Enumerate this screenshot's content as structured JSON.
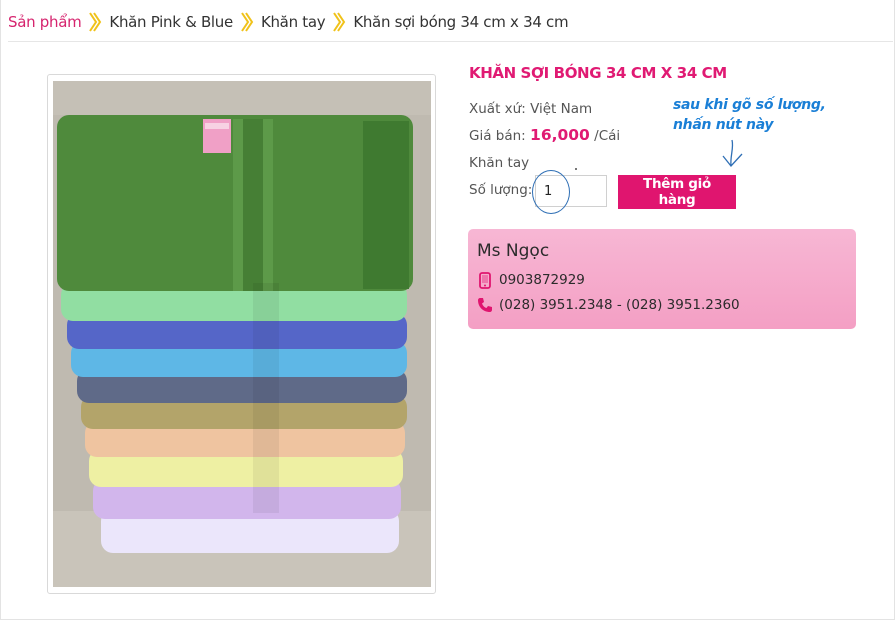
{
  "breadcrumb": {
    "items": [
      "Sản phẩm",
      "Khăn Pink & Blue",
      "Khăn tay",
      "Khăn sợi bóng 34 cm x 34 cm"
    ],
    "separator_icon": "double-chevron-right-icon",
    "accent_color": "#d6246e",
    "separator_color": "#f0c21a"
  },
  "product": {
    "title": "KHĂN SỢI BÓNG 34 CM X 34 CM",
    "origin_label": "Xuất xứ:",
    "origin_value": "Việt Nam",
    "price_label": "Giá bán:",
    "price_value": "16,000",
    "price_unit": "/Cái",
    "category": "Khăn tay",
    "quantity_label": "Số lượng:",
    "quantity_value": "1",
    "add_to_cart_label": "Thêm giỏ hàng",
    "image_alt": "towel-stack-image"
  },
  "annotation": {
    "line1": "sau khi gõ số lượng,",
    "line2": "nhấn nút này",
    "color": "#1a7fd6"
  },
  "contact": {
    "name": "Ms Ngọc",
    "mobile": "0903872929",
    "phones": "(028) 3951.2348 - (028) 3951.2360",
    "mobile_icon": "mobile-phone-icon",
    "phone_icon": "telephone-icon",
    "box_color": "#f4a6c8"
  },
  "colors": {
    "brand_pink": "#e0156f"
  }
}
